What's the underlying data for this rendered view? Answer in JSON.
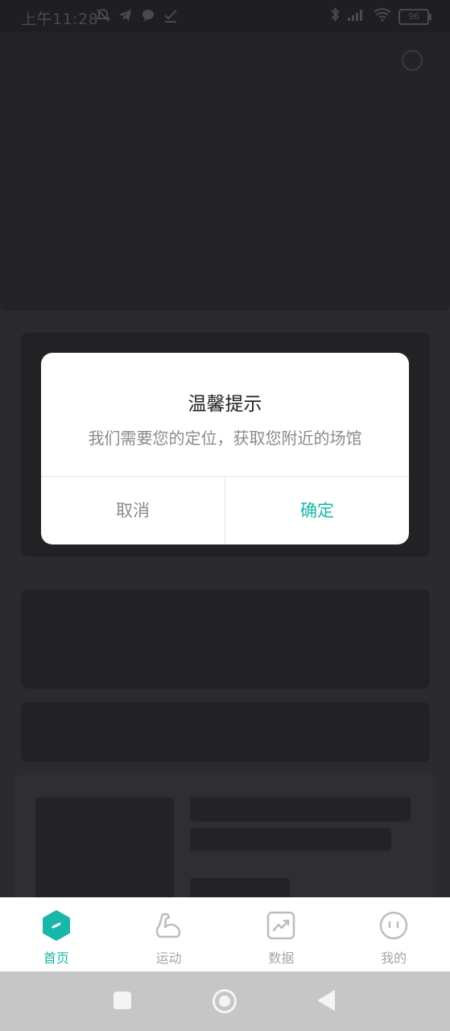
{
  "status_bar": {
    "time": "上午11:28",
    "battery": "96",
    "left_icons": [
      "mute-bell-icon",
      "telegram-icon",
      "chat-icon",
      "check-icon"
    ],
    "right_icons": [
      "bluetooth-icon",
      "signal-icon",
      "wifi-icon",
      "battery-icon"
    ]
  },
  "dialog": {
    "title": "温馨提示",
    "message": "我们需要您的定位，获取您附近的场馆",
    "cancel_label": "取消",
    "confirm_label": "确定",
    "accent_color": "#18b7a8"
  },
  "bottom_nav": {
    "items": [
      {
        "label": "首页",
        "icon": "home-hexagon-icon",
        "active": true
      },
      {
        "label": "运动",
        "icon": "exercise-arm-icon",
        "active": false
      },
      {
        "label": "数据",
        "icon": "chart-trend-icon",
        "active": false
      },
      {
        "label": "我的",
        "icon": "profile-face-icon",
        "active": false
      }
    ]
  },
  "system_nav": {
    "buttons": [
      "recents-button",
      "home-button",
      "back-button"
    ]
  }
}
